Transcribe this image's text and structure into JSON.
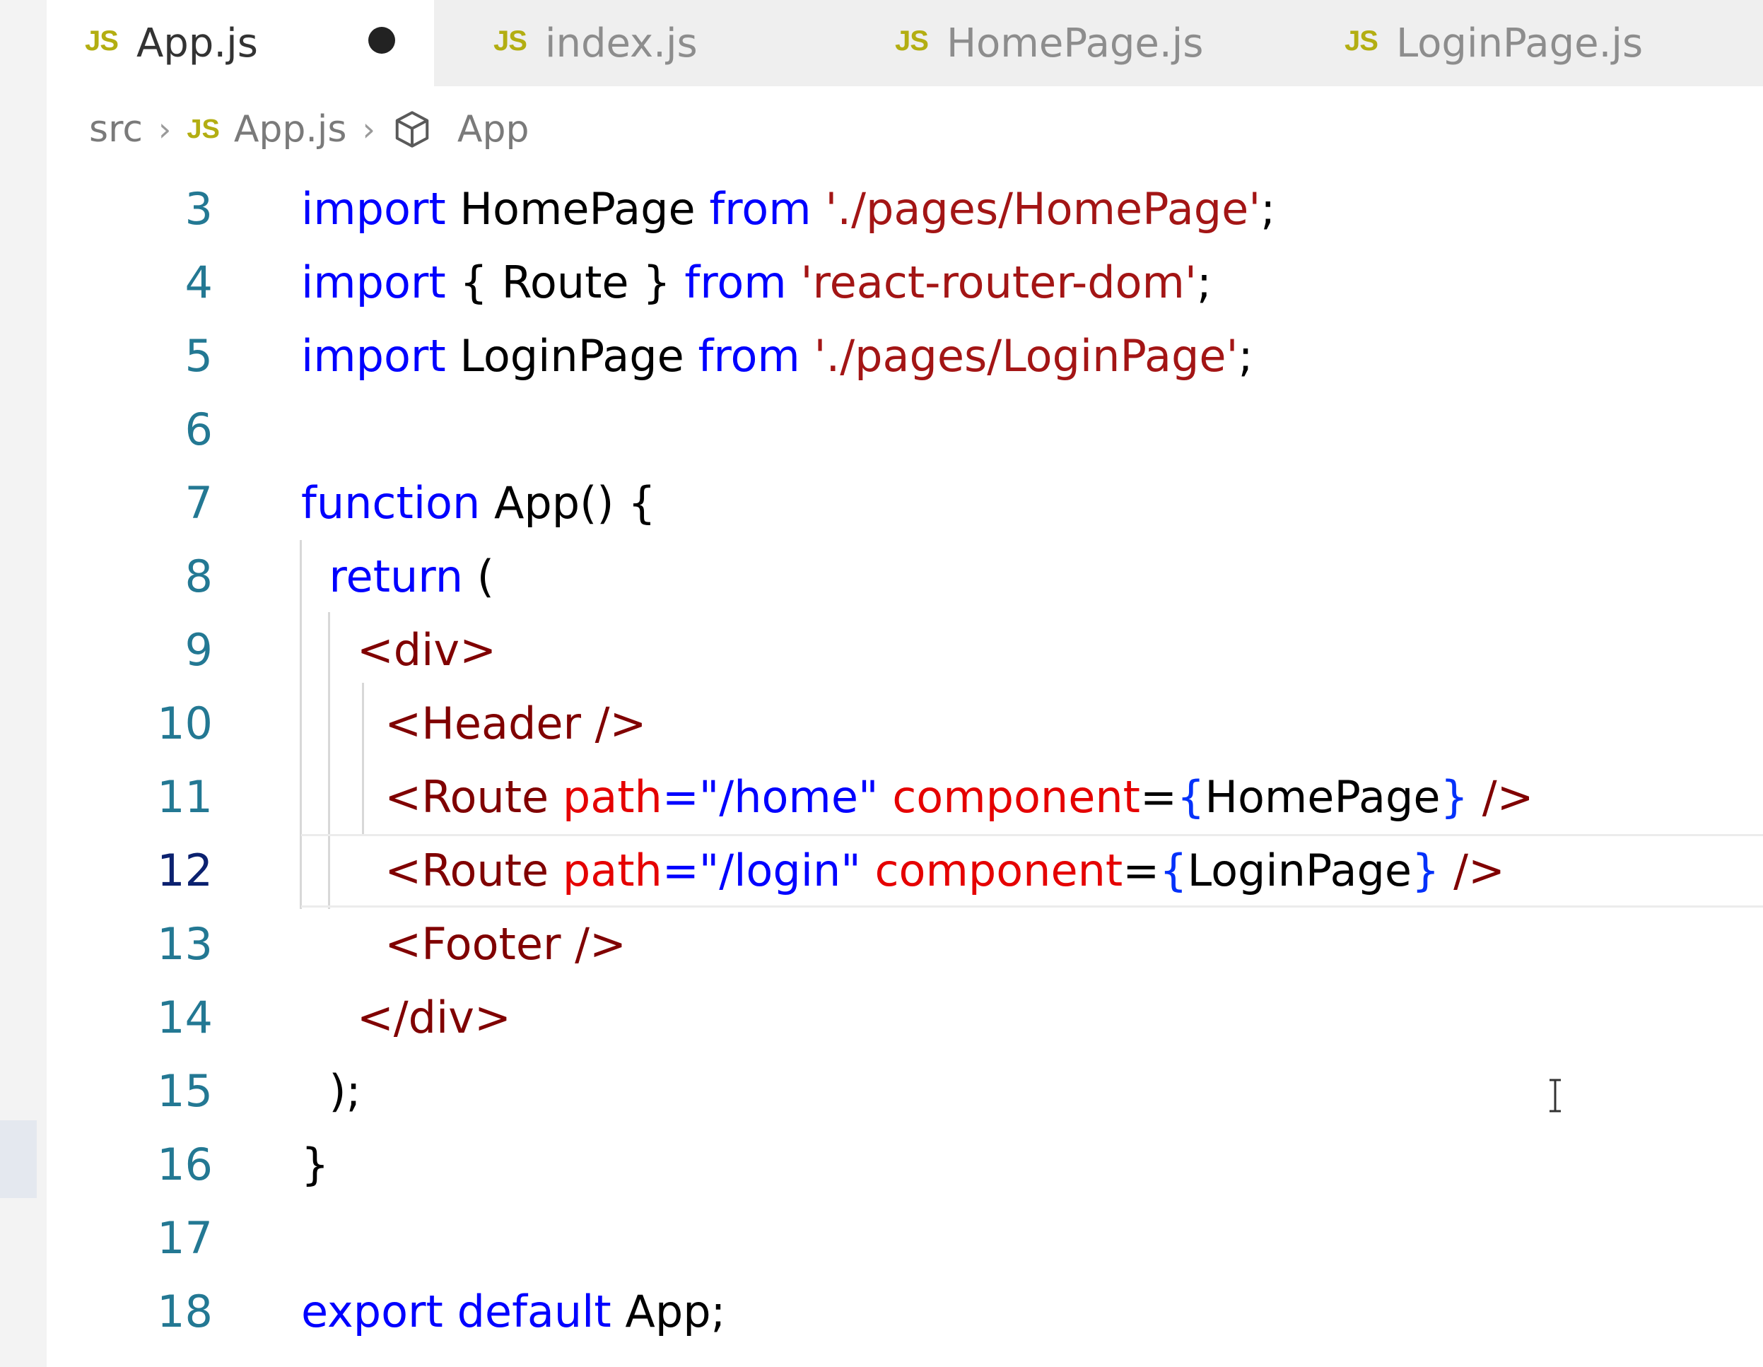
{
  "tabs": [
    {
      "icon": "JS",
      "label": "App.js",
      "active": true,
      "modified": true
    },
    {
      "icon": "JS",
      "label": "index.js",
      "active": false,
      "modified": false
    },
    {
      "icon": "JS",
      "label": "HomePage.js",
      "active": false,
      "modified": false
    },
    {
      "icon": "JS",
      "label": "LoginPage.js",
      "active": false,
      "modified": false
    }
  ],
  "breadcrumb": {
    "folder": "src",
    "file_icon": "JS",
    "file": "App.js",
    "symbol_icon": "cube-icon",
    "symbol": "App"
  },
  "editor": {
    "current_line": "12",
    "lines": [
      {
        "num": "3",
        "tokens": [
          {
            "t": "import",
            "c": "kw"
          },
          {
            "t": " HomePage "
          },
          {
            "t": "from",
            "c": "kw"
          },
          {
            "t": " "
          },
          {
            "t": "'./pages/HomePage'",
            "c": "str"
          },
          {
            "t": ";"
          }
        ]
      },
      {
        "num": "4",
        "tokens": [
          {
            "t": "import",
            "c": "kw"
          },
          {
            "t": " { Route } "
          },
          {
            "t": "from",
            "c": "kw"
          },
          {
            "t": " "
          },
          {
            "t": "'react-router-dom'",
            "c": "str"
          },
          {
            "t": ";"
          }
        ]
      },
      {
        "num": "5",
        "tokens": [
          {
            "t": "import",
            "c": "kw"
          },
          {
            "t": " LoginPage "
          },
          {
            "t": "from",
            "c": "kw"
          },
          {
            "t": " "
          },
          {
            "t": "'./pages/LoginPage'",
            "c": "str"
          },
          {
            "t": ";"
          }
        ]
      },
      {
        "num": "6",
        "tokens": []
      },
      {
        "num": "7",
        "tokens": [
          {
            "t": "function",
            "c": "kw"
          },
          {
            "t": " App() {"
          }
        ]
      },
      {
        "num": "8",
        "tokens": [
          {
            "t": "  "
          },
          {
            "t": "return",
            "c": "kw"
          },
          {
            "t": " ("
          }
        ]
      },
      {
        "num": "9",
        "tokens": [
          {
            "t": "    "
          },
          {
            "t": "<div>",
            "c": "tag"
          }
        ]
      },
      {
        "num": "10",
        "tokens": [
          {
            "t": "      "
          },
          {
            "t": "<Header />",
            "c": "tag"
          }
        ]
      },
      {
        "num": "11",
        "tokens": [
          {
            "t": "      "
          },
          {
            "t": "<Route ",
            "c": "tag"
          },
          {
            "t": "path",
            "c": "attr"
          },
          {
            "t": "=\"/home\" ",
            "c": "kw"
          },
          {
            "t": "component",
            "c": "attr"
          },
          {
            "t": "="
          },
          {
            "t": "{",
            "c": "br"
          },
          {
            "t": "HomePage"
          },
          {
            "t": "}",
            "c": "br"
          },
          {
            "t": " />",
            "c": "tag"
          }
        ]
      },
      {
        "num": "12",
        "tokens": [
          {
            "t": "      "
          },
          {
            "t": "<Route ",
            "c": "tag"
          },
          {
            "t": "path",
            "c": "attr"
          },
          {
            "t": "=\"/login\" ",
            "c": "kw"
          },
          {
            "t": "component",
            "c": "attr"
          },
          {
            "t": "="
          },
          {
            "t": "{",
            "c": "br"
          },
          {
            "t": "LoginPage"
          },
          {
            "t": "}",
            "c": "br"
          },
          {
            "t": " />",
            "c": "tag"
          }
        ]
      },
      {
        "num": "13",
        "tokens": [
          {
            "t": "      "
          },
          {
            "t": "<Footer />",
            "c": "tag"
          }
        ]
      },
      {
        "num": "14",
        "tokens": [
          {
            "t": "    "
          },
          {
            "t": "</div>",
            "c": "tag"
          }
        ]
      },
      {
        "num": "15",
        "tokens": [
          {
            "t": "  );"
          }
        ]
      },
      {
        "num": "16",
        "tokens": [
          {
            "t": "}"
          }
        ]
      },
      {
        "num": "17",
        "tokens": []
      },
      {
        "num": "18",
        "tokens": [
          {
            "t": "export",
            "c": "kw"
          },
          {
            "t": " "
          },
          {
            "t": "default",
            "c": "kw"
          },
          {
            "t": " App;"
          }
        ]
      }
    ]
  }
}
